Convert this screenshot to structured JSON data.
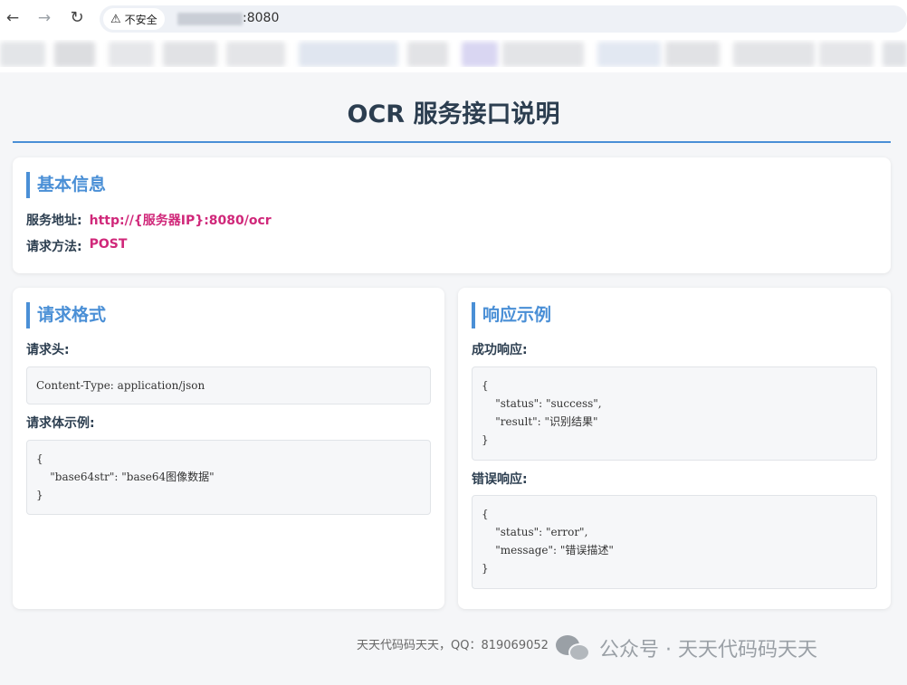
{
  "browser": {
    "back_icon": "←",
    "forward_icon": "→",
    "reload_icon": "↻",
    "security_label": "不安全",
    "url_port": ":8080"
  },
  "page": {
    "title": "OCR 服务接口说明"
  },
  "basic_info": {
    "heading": "基本信息",
    "service_address_label": "服务地址:",
    "service_address_value": "http://{服务器IP}:8080/ocr",
    "method_label": "请求方法:",
    "method_value": "POST"
  },
  "request_format": {
    "heading": "请求格式",
    "header_label": "请求头:",
    "header_code": "Content-Type: application/json",
    "body_label": "请求体示例:",
    "body_code": [
      "{",
      "    \"base64str\": \"base64图像数据\"",
      "}"
    ]
  },
  "response_example": {
    "heading": "响应示例",
    "success_label": "成功响应:",
    "success_code": [
      "{",
      "    \"status\": \"success\",",
      "    \"result\": \"识别结果\"",
      "}"
    ],
    "error_label": "错误响应:",
    "error_code": [
      "{",
      "    \"status\": \"error\",",
      "    \"message\": \"错误描述\"",
      "}"
    ]
  },
  "footer": {
    "text": "天天代码码天天，QQ：819069052"
  },
  "watermark": {
    "text": "公众号 · 天天代码码天天"
  },
  "colors": {
    "accent": "#4a8fd6",
    "value": "#d0287a",
    "heading_text": "#2c3e50"
  }
}
